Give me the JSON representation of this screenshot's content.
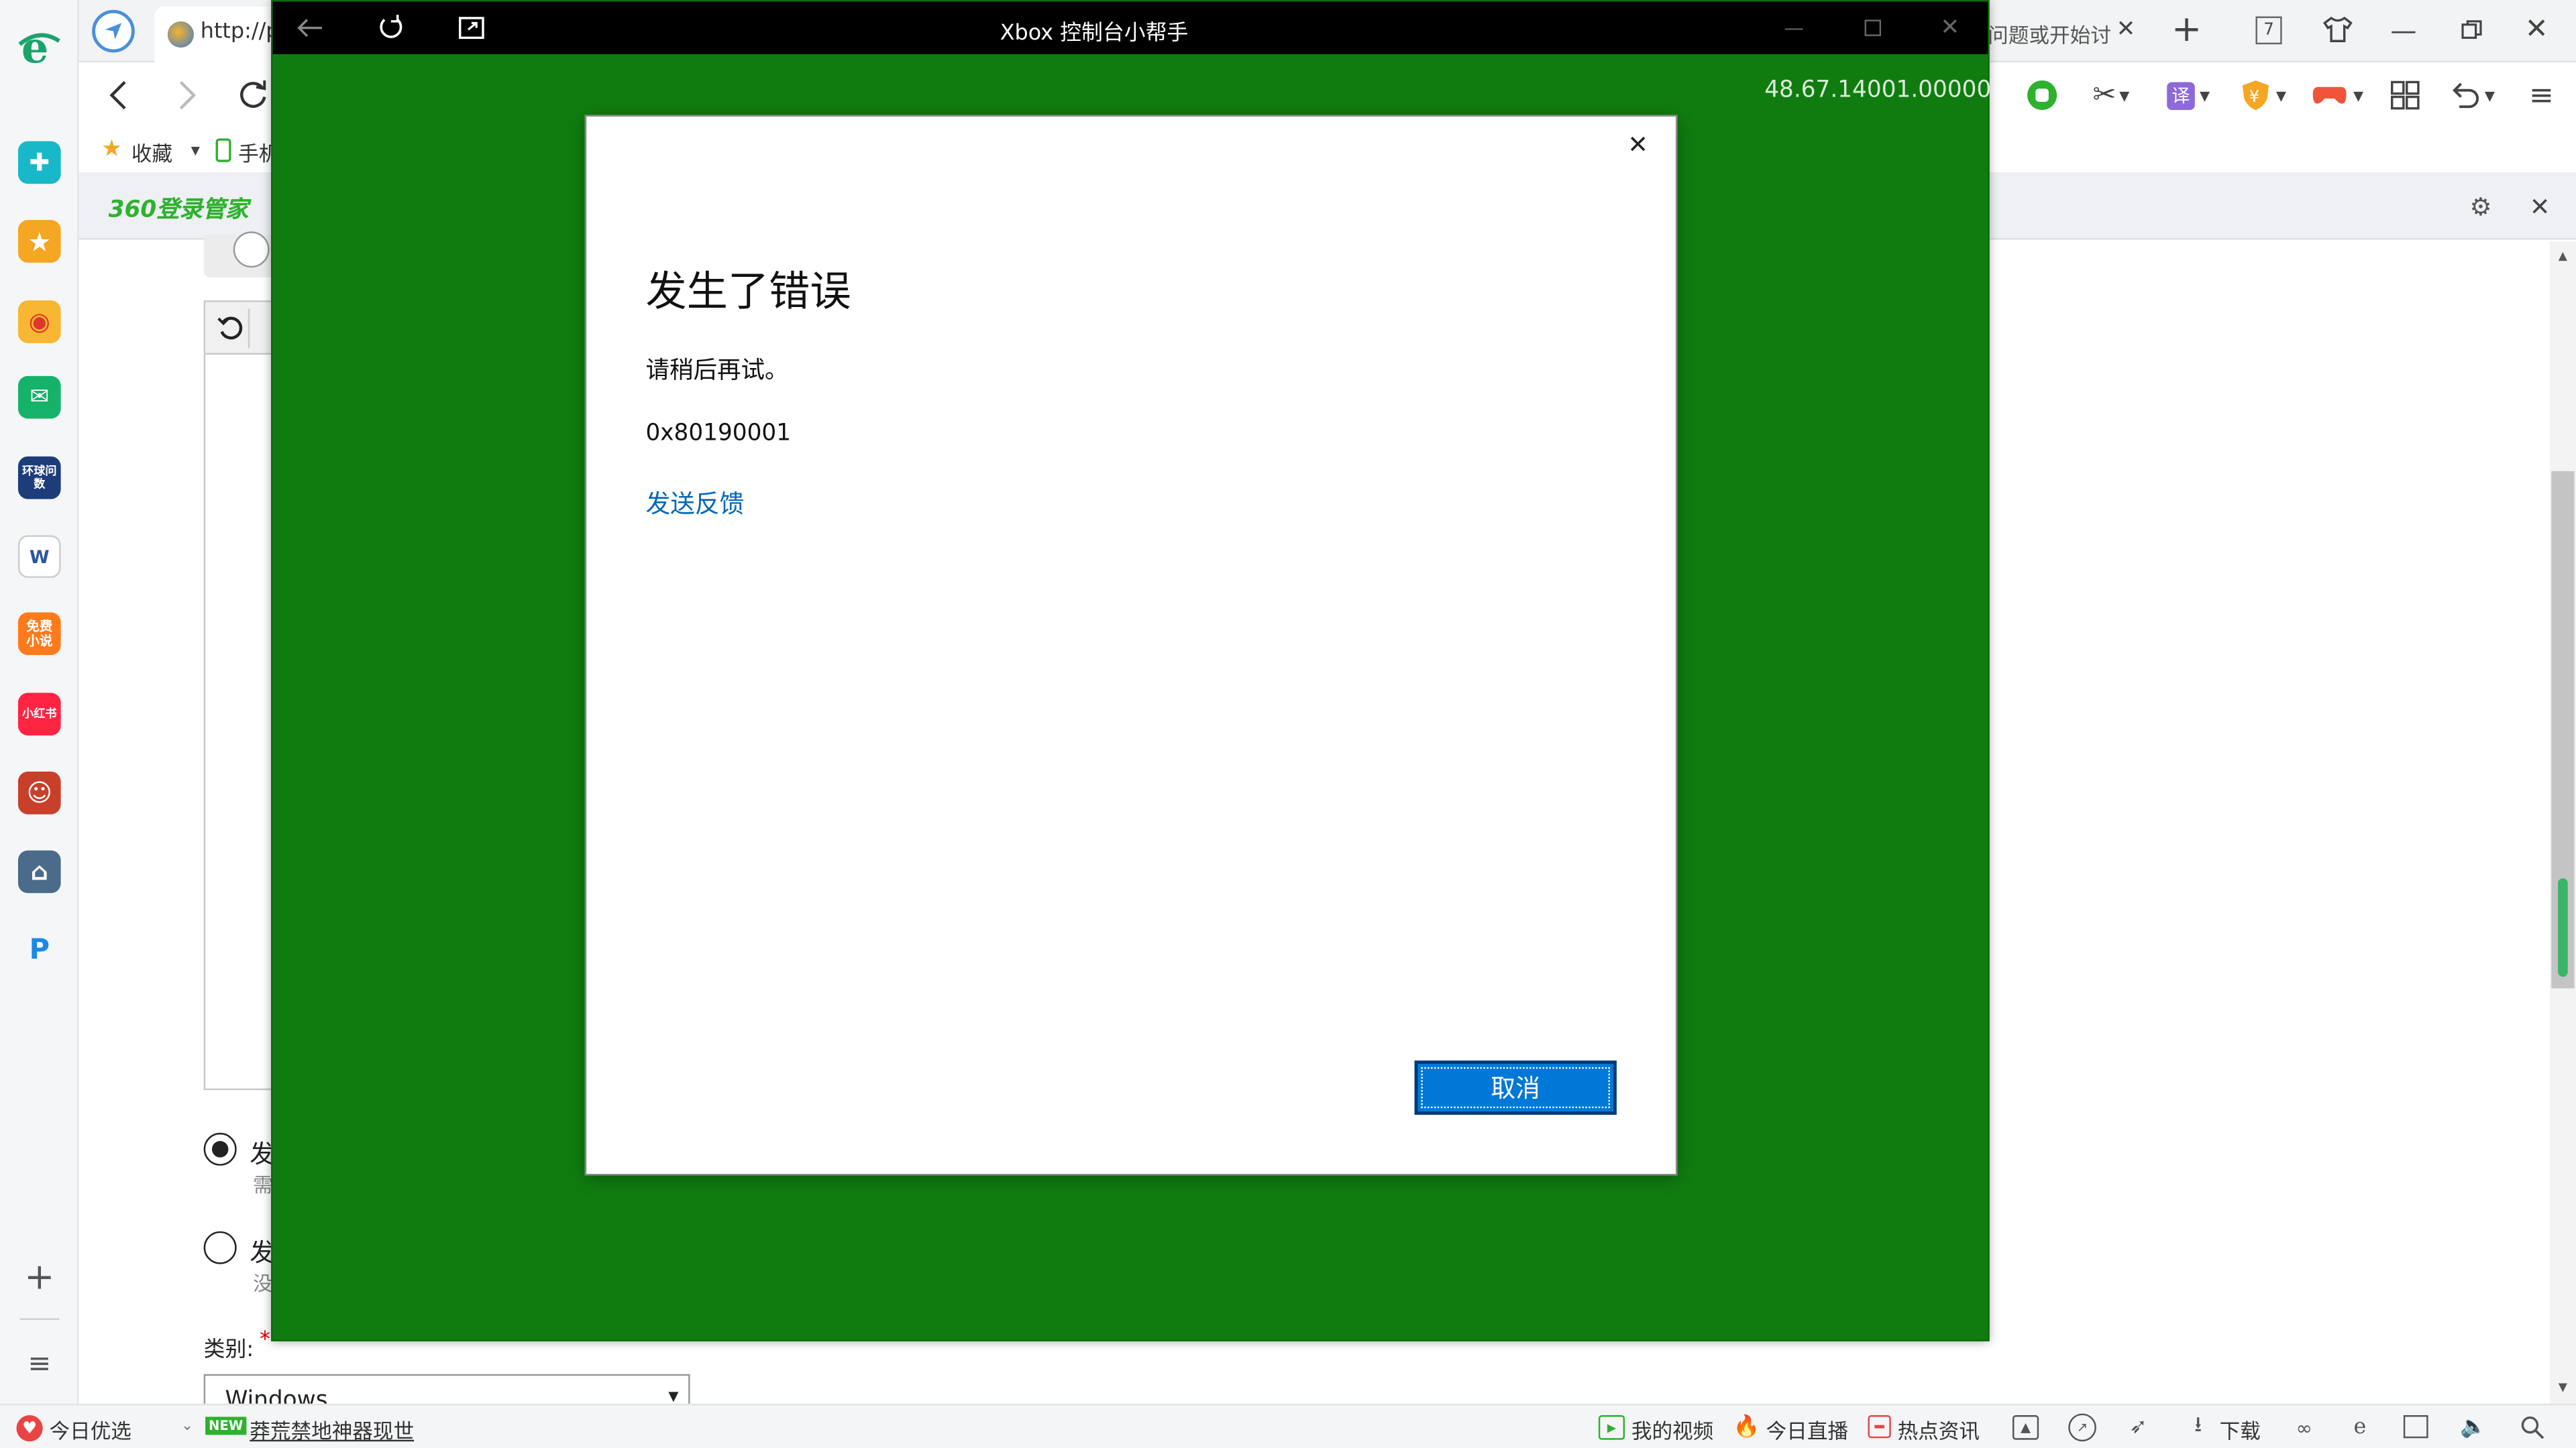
{
  "sidebar": {
    "apps": [
      {
        "icon": "ie-browser-icon",
        "label": "e"
      },
      {
        "icon": "health-cross-icon",
        "label": "✚"
      },
      {
        "icon": "favorites-star-icon",
        "label": "★"
      },
      {
        "icon": "weibo-icon",
        "label": "◉"
      },
      {
        "icon": "mail-icon",
        "label": "✉"
      },
      {
        "icon": "huanqiu-wenjuan-icon",
        "label": "环球问数"
      },
      {
        "icon": "word-doc-icon",
        "label": "W"
      },
      {
        "icon": "free-novel-icon",
        "label": "免费小说"
      },
      {
        "icon": "xiaohongshu-icon",
        "label": "小红书"
      },
      {
        "icon": "game-avatar-icon",
        "label": "☺"
      },
      {
        "icon": "game-city-icon",
        "label": "⌂"
      },
      {
        "icon": "p-app-icon",
        "label": "P"
      }
    ],
    "add_label": "+",
    "menu_label": "≡"
  },
  "browser": {
    "tab_url": "http://p",
    "right_tab_title": "问题或开始讨",
    "tab_count": "7",
    "favorites_label": "收藏",
    "mobile_label": "手机",
    "translate_label": "译",
    "notif_brand": "360登录管家"
  },
  "page": {
    "radio1_label": "发",
    "radio1_sub": "需",
    "radio2_label": "发",
    "radio2_sub": "没",
    "category_label": "类别:",
    "required_mark": "*",
    "category_value": "Windows"
  },
  "xbox": {
    "title": "Xbox 控制台小帮手",
    "version": "48.67.14001.00000",
    "dialog": {
      "heading": "发生了错误",
      "message": "请稍后再试。",
      "error_code": "0x80190001",
      "feedback_link": "发送反馈",
      "cancel_label": "取消"
    }
  },
  "statusbar": {
    "today_picks": "今日优选",
    "new_badge": "NEW",
    "promo": "莽荒禁地神器现世",
    "my_videos": "我的视频",
    "live": "今日直播",
    "hot_news": "热点资讯",
    "download": "下载"
  },
  "colors": {
    "xbox_green": "#107c10",
    "accent_blue": "#0078d7",
    "link_blue": "#0067b8",
    "brand_green": "#2db22d"
  }
}
